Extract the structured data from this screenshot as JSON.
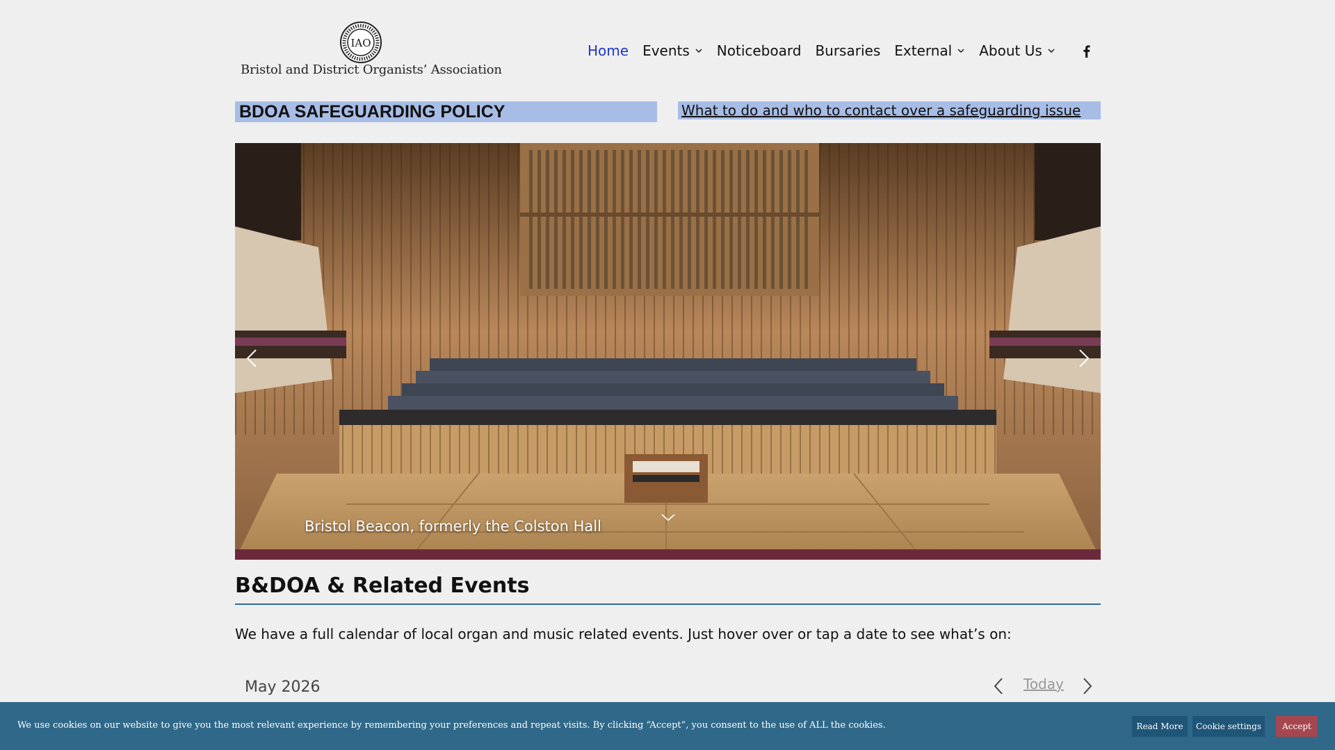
{
  "header": {
    "logo_text": "Bristol and District Organists’ Association",
    "logo_emblem_monogram": "IAO",
    "logo_emblem_ring_text": "BRISTOL & DISTRICT ORGANISTS ASSOCIATION",
    "nav": [
      {
        "label": "Home",
        "active": true,
        "has_dropdown": false
      },
      {
        "label": "Events",
        "active": false,
        "has_dropdown": true
      },
      {
        "label": "Noticeboard",
        "active": false,
        "has_dropdown": false
      },
      {
        "label": "Bursaries",
        "active": false,
        "has_dropdown": false
      },
      {
        "label": "External",
        "active": false,
        "has_dropdown": true
      },
      {
        "label": "About Us",
        "active": false,
        "has_dropdown": true
      }
    ],
    "social_icon": "facebook-icon",
    "active_color": "#1e35c9"
  },
  "safeguarding": {
    "title": "BDOA SAFEGUARDING POLICY",
    "link": "What to do and who to contact over a safeguarding issue",
    "highlight_color": "#a7bde6"
  },
  "slider": {
    "caption": "Bristol Beacon, formerly the Colston Hall",
    "prev_icon": "chevron-left-icon",
    "next_icon": "chevron-right-icon",
    "scroll_icon": "chevron-down-icon"
  },
  "events": {
    "heading": "B&DOA & Related Events",
    "intro": "We have a full calendar of local organ and music related events. Just hover over or tap a date to see what’s on:",
    "calendar": {
      "month": "May 2026",
      "today_label": "Today"
    },
    "rule_color": "#2c6a9b"
  },
  "cookie": {
    "text": "We use cookies on our website to give you the most relevant experience by remembering your preferences and repeat visits. By clicking “Accept”, you consent to the use of ALL the cookies.",
    "read_more": "Read More",
    "settings": "Cookie settings",
    "accept": "Accept",
    "bar_color": "#2f6889",
    "accept_color": "#a6474f"
  }
}
